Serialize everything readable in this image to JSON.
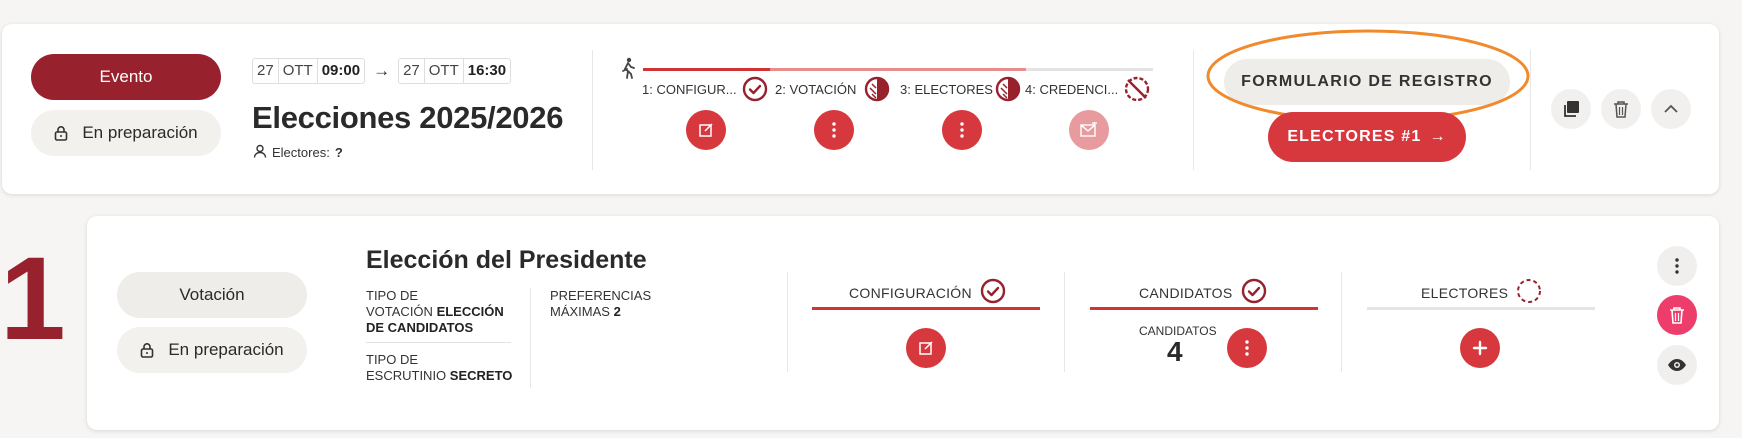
{
  "event": {
    "type_label": "Evento",
    "status_label": "En preparación",
    "start": {
      "day": "27",
      "month": "OTT",
      "time": "09:00"
    },
    "arrow": "→",
    "end": {
      "day": "27",
      "month": "OTT",
      "time": "16:30"
    },
    "title": "Elecciones 2025/2026",
    "voters_label": "Electores:",
    "voters_value": "?",
    "steps": [
      {
        "label": "1: CONFIGUR...",
        "state": "done"
      },
      {
        "label": "2: VOTACIÓN",
        "state": "partial"
      },
      {
        "label": "3: ELECTORES",
        "state": "partial"
      },
      {
        "label": "4: CREDENCI...",
        "state": "blocked"
      }
    ],
    "registration_button": "FORMULARIO DE REGISTRO",
    "electors_button": "ELECTORES #1",
    "electors_arrow": "→"
  },
  "voting": {
    "index": "1",
    "type_label": "Votación",
    "status_label": "En preparación",
    "title": "Elección del Presidente",
    "voting_type_label_1": "TIPO DE",
    "voting_type_label_2": "VOTACIÓN",
    "voting_type_value_1": "ELECCIÓN",
    "voting_type_value_2": "DE CANDIDATOS",
    "counting_label_1": "TIPO DE",
    "counting_label_2": "ESCRUTINIO",
    "counting_value": "SECRETO",
    "preferences_label_1": "PREFERENCIAS",
    "preferences_label_2": "MÁXIMAS",
    "preferences_value": "2",
    "columns": {
      "configuration": "CONFIGURACIÓN",
      "candidates": "CANDIDATOS",
      "electors": "ELECTORES"
    },
    "candidates_count_label": "CANDIDATOS",
    "candidates_count": "4"
  },
  "colors": {
    "brand": "#97212d",
    "accent": "#d7383d",
    "danger": "#ec3d6b",
    "highlight": "#f08a2c"
  }
}
